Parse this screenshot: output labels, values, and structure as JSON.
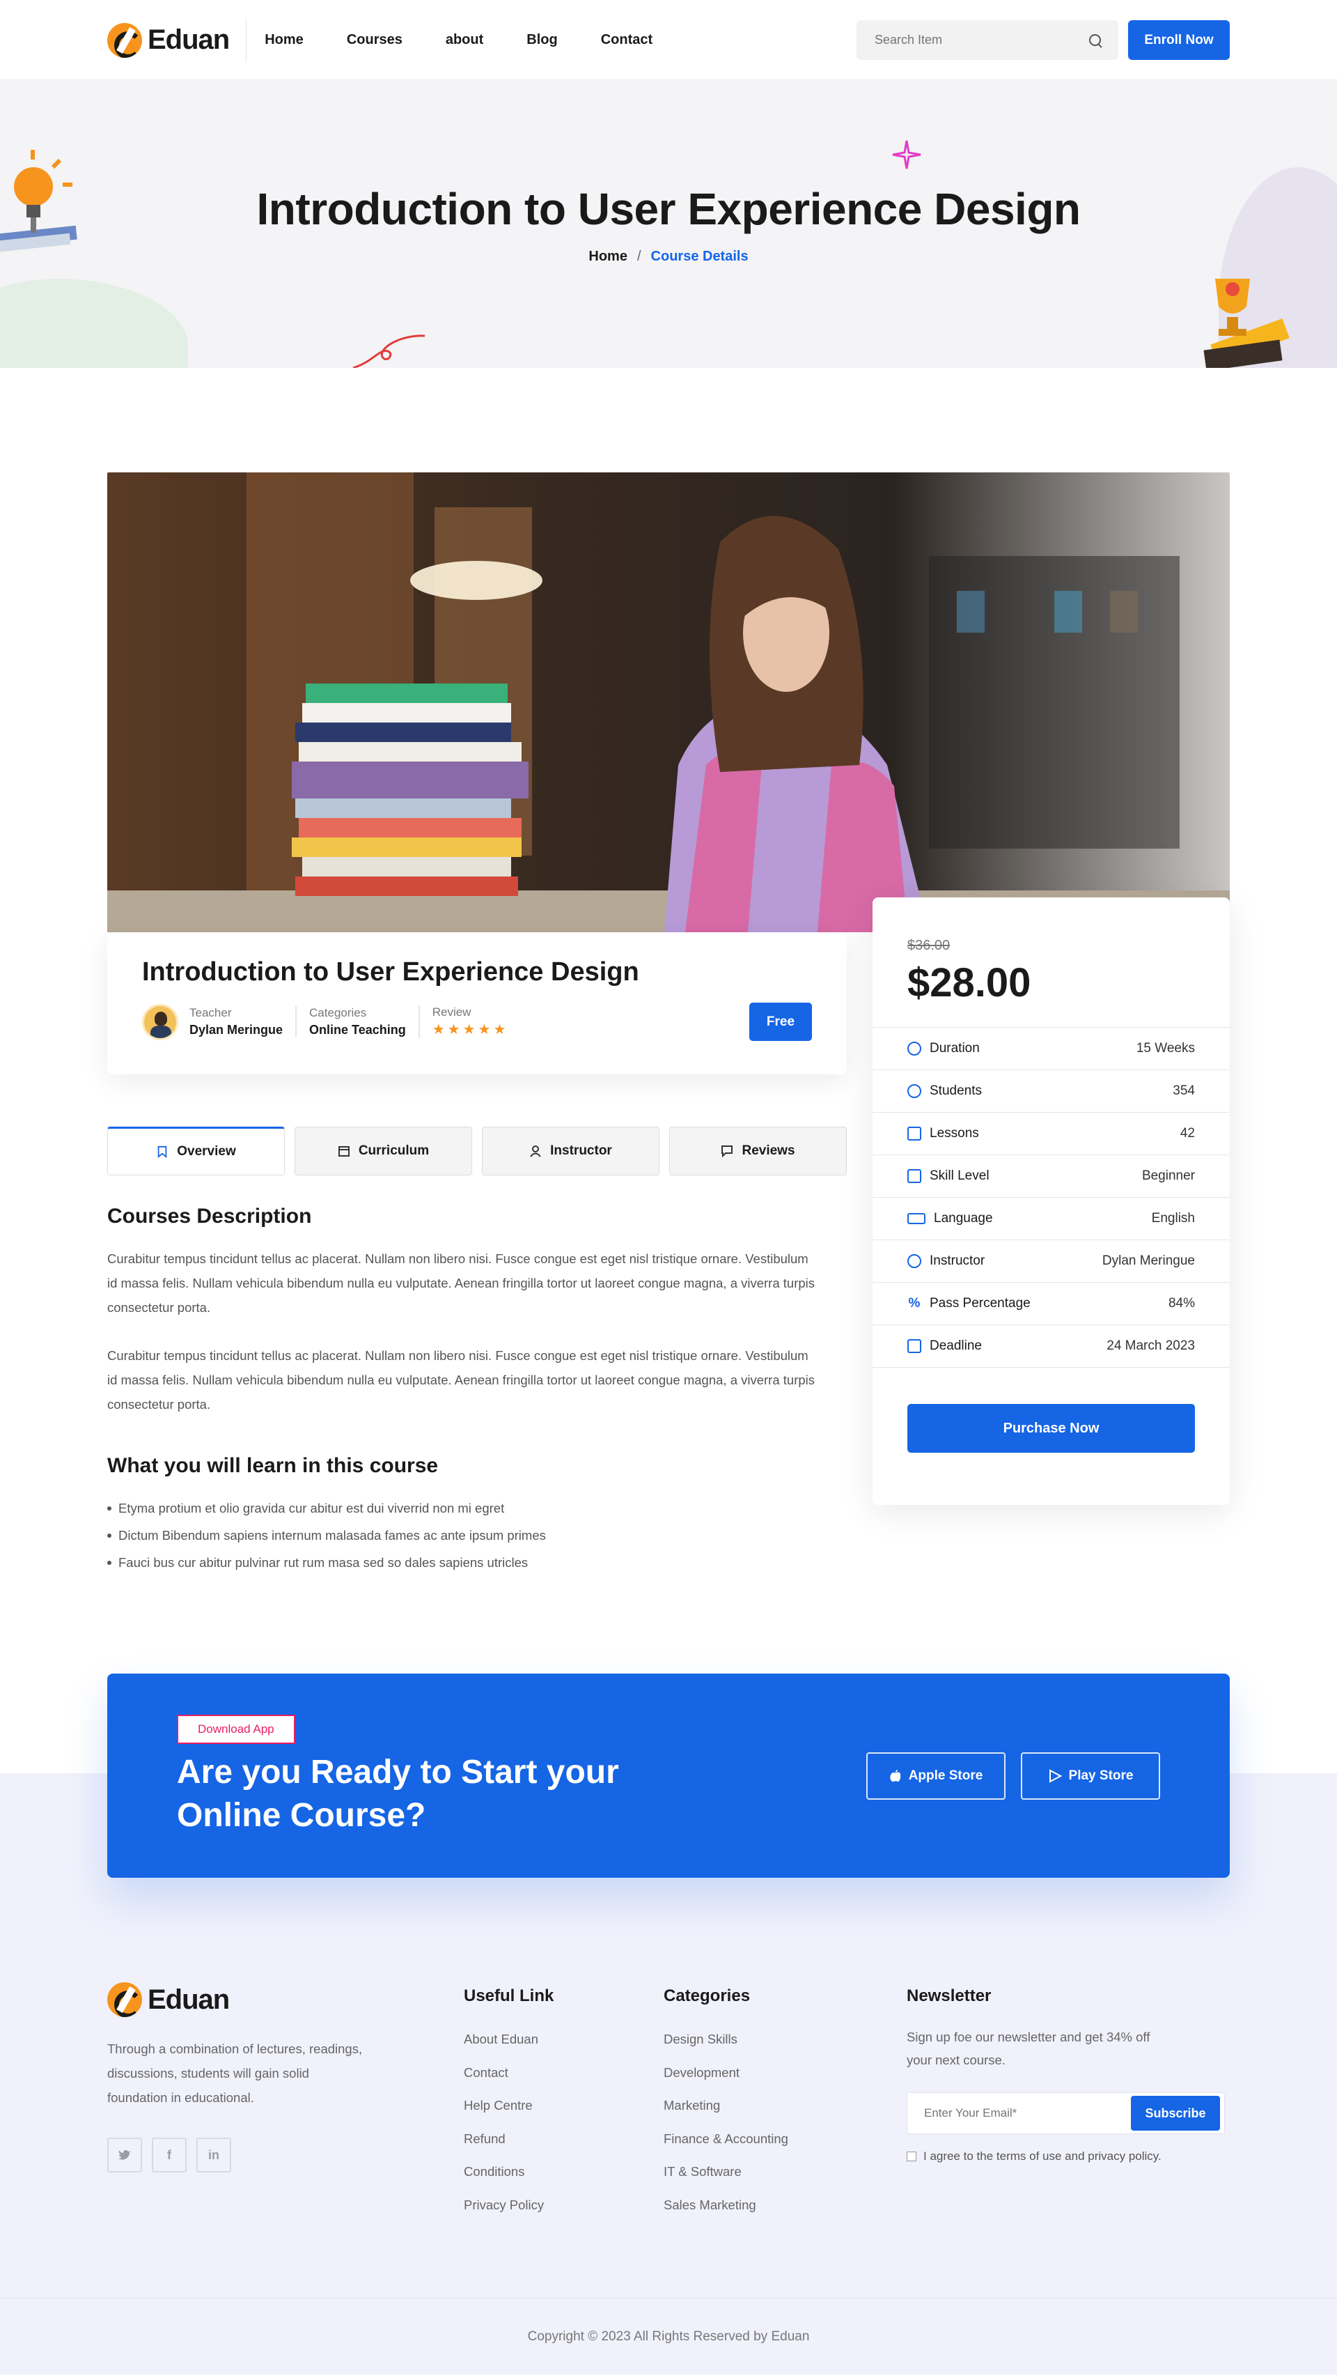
{
  "header": {
    "logo": "Eduan",
    "nav": [
      "Home",
      "Courses",
      "about",
      "Blog",
      "Contact"
    ],
    "search_placeholder": "Search Item",
    "enroll_label": "Enroll Now"
  },
  "hero": {
    "title": "Introduction to User Experience Design",
    "breadcrumb_home": "Home",
    "breadcrumb_sep": "/",
    "breadcrumb_current": "Course Details"
  },
  "course": {
    "title": "Introduction to User Experience Design",
    "teacher_label": "Teacher",
    "teacher": "Dylan Meringue",
    "categories_label": "Categories",
    "category": "Online Teaching",
    "review_label": "Review",
    "rating": 5,
    "stars": "★★★★★",
    "price_tag": "Free"
  },
  "tabs": [
    "Overview",
    "Curriculum",
    "Instructor",
    "Reviews"
  ],
  "description": {
    "title": "Courses Description",
    "para1": "Curabitur tempus tincidunt tellus ac placerat. Nullam non libero nisi. Fusce congue est eget nisl tristique ornare. Vestibulum id massa felis. Nullam vehicula bibendum nulla eu vulputate. Aenean fringilla tortor ut laoreet congue magna, a viverra turpis consectetur porta.",
    "para2": "Curabitur tempus tincidunt tellus ac placerat. Nullam non libero nisi. Fusce congue est eget nisl tristique ornare. Vestibulum id massa felis. Nullam vehicula bibendum nulla eu vulputate. Aenean fringilla tortor ut laoreet congue magna, a viverra turpis consectetur porta."
  },
  "learn": {
    "title": "What you will learn in this course",
    "items": [
      "Etyma protium et olio gravida cur abitur est dui viverrid non mi egret",
      "Dictum Bibendum sapiens internum malasada fames ac ante ipsum primes",
      "Fauci bus cur abitur pulvinar rut rum masa sed so dales sapiens utricles"
    ]
  },
  "pricing": {
    "old_price": "$36.00",
    "price": "$28.00",
    "specs": [
      {
        "label": "Duration",
        "value": "15 Weeks",
        "icon": "clock-icon"
      },
      {
        "label": "Students",
        "value": "354",
        "icon": "users-icon"
      },
      {
        "label": "Lessons",
        "value": "42",
        "icon": "file-icon"
      },
      {
        "label": "Skill Level",
        "value": "Beginner",
        "icon": "chart-icon"
      },
      {
        "label": "Language",
        "value": "English",
        "icon": "language-icon"
      },
      {
        "label": "Instructor",
        "value": "Dylan Meringue",
        "icon": "user-icon"
      },
      {
        "label": "Pass Percentage",
        "value": "84%",
        "icon": "percent-icon"
      },
      {
        "label": "Deadline",
        "value": "24 March 2023",
        "icon": "calendar-icon"
      }
    ],
    "purchase_label": "Purchase Now"
  },
  "cta": {
    "badge": "Download App",
    "title": "Are you Ready to Start your Online Course?",
    "apple": "Apple Store",
    "play": "Play Store"
  },
  "footer": {
    "logo": "Eduan",
    "desc": "Through a combination of lectures, readings, discussions, students will gain solid foundation in educational.",
    "socials": [
      "twitter-icon",
      "facebook-icon",
      "linkedin-icon"
    ],
    "useful_title": "Useful Link",
    "useful": [
      "About Eduan",
      "Contact",
      "Help Centre",
      "Refund",
      "Conditions",
      "Privacy Policy"
    ],
    "categories_title": "Categories",
    "categories": [
      "Design Skills",
      "Development",
      "Marketing",
      "Finance & Accounting",
      "IT & Software",
      "Sales Marketing"
    ],
    "newsletter_title": "Newsletter",
    "newsletter_text": "Sign up foe our newsletter and get 34% off your next course.",
    "email_placeholder": "Enter Your Email*",
    "subscribe_label": "Subscribe",
    "agree": "I agree to the terms of use and privacy policy.",
    "copyright": "Copyright © 2023 All Rights Reserved by Eduan"
  },
  "colors": {
    "accent": "#1565e5",
    "orange": "#f7941d",
    "pink": "#e91e63"
  }
}
